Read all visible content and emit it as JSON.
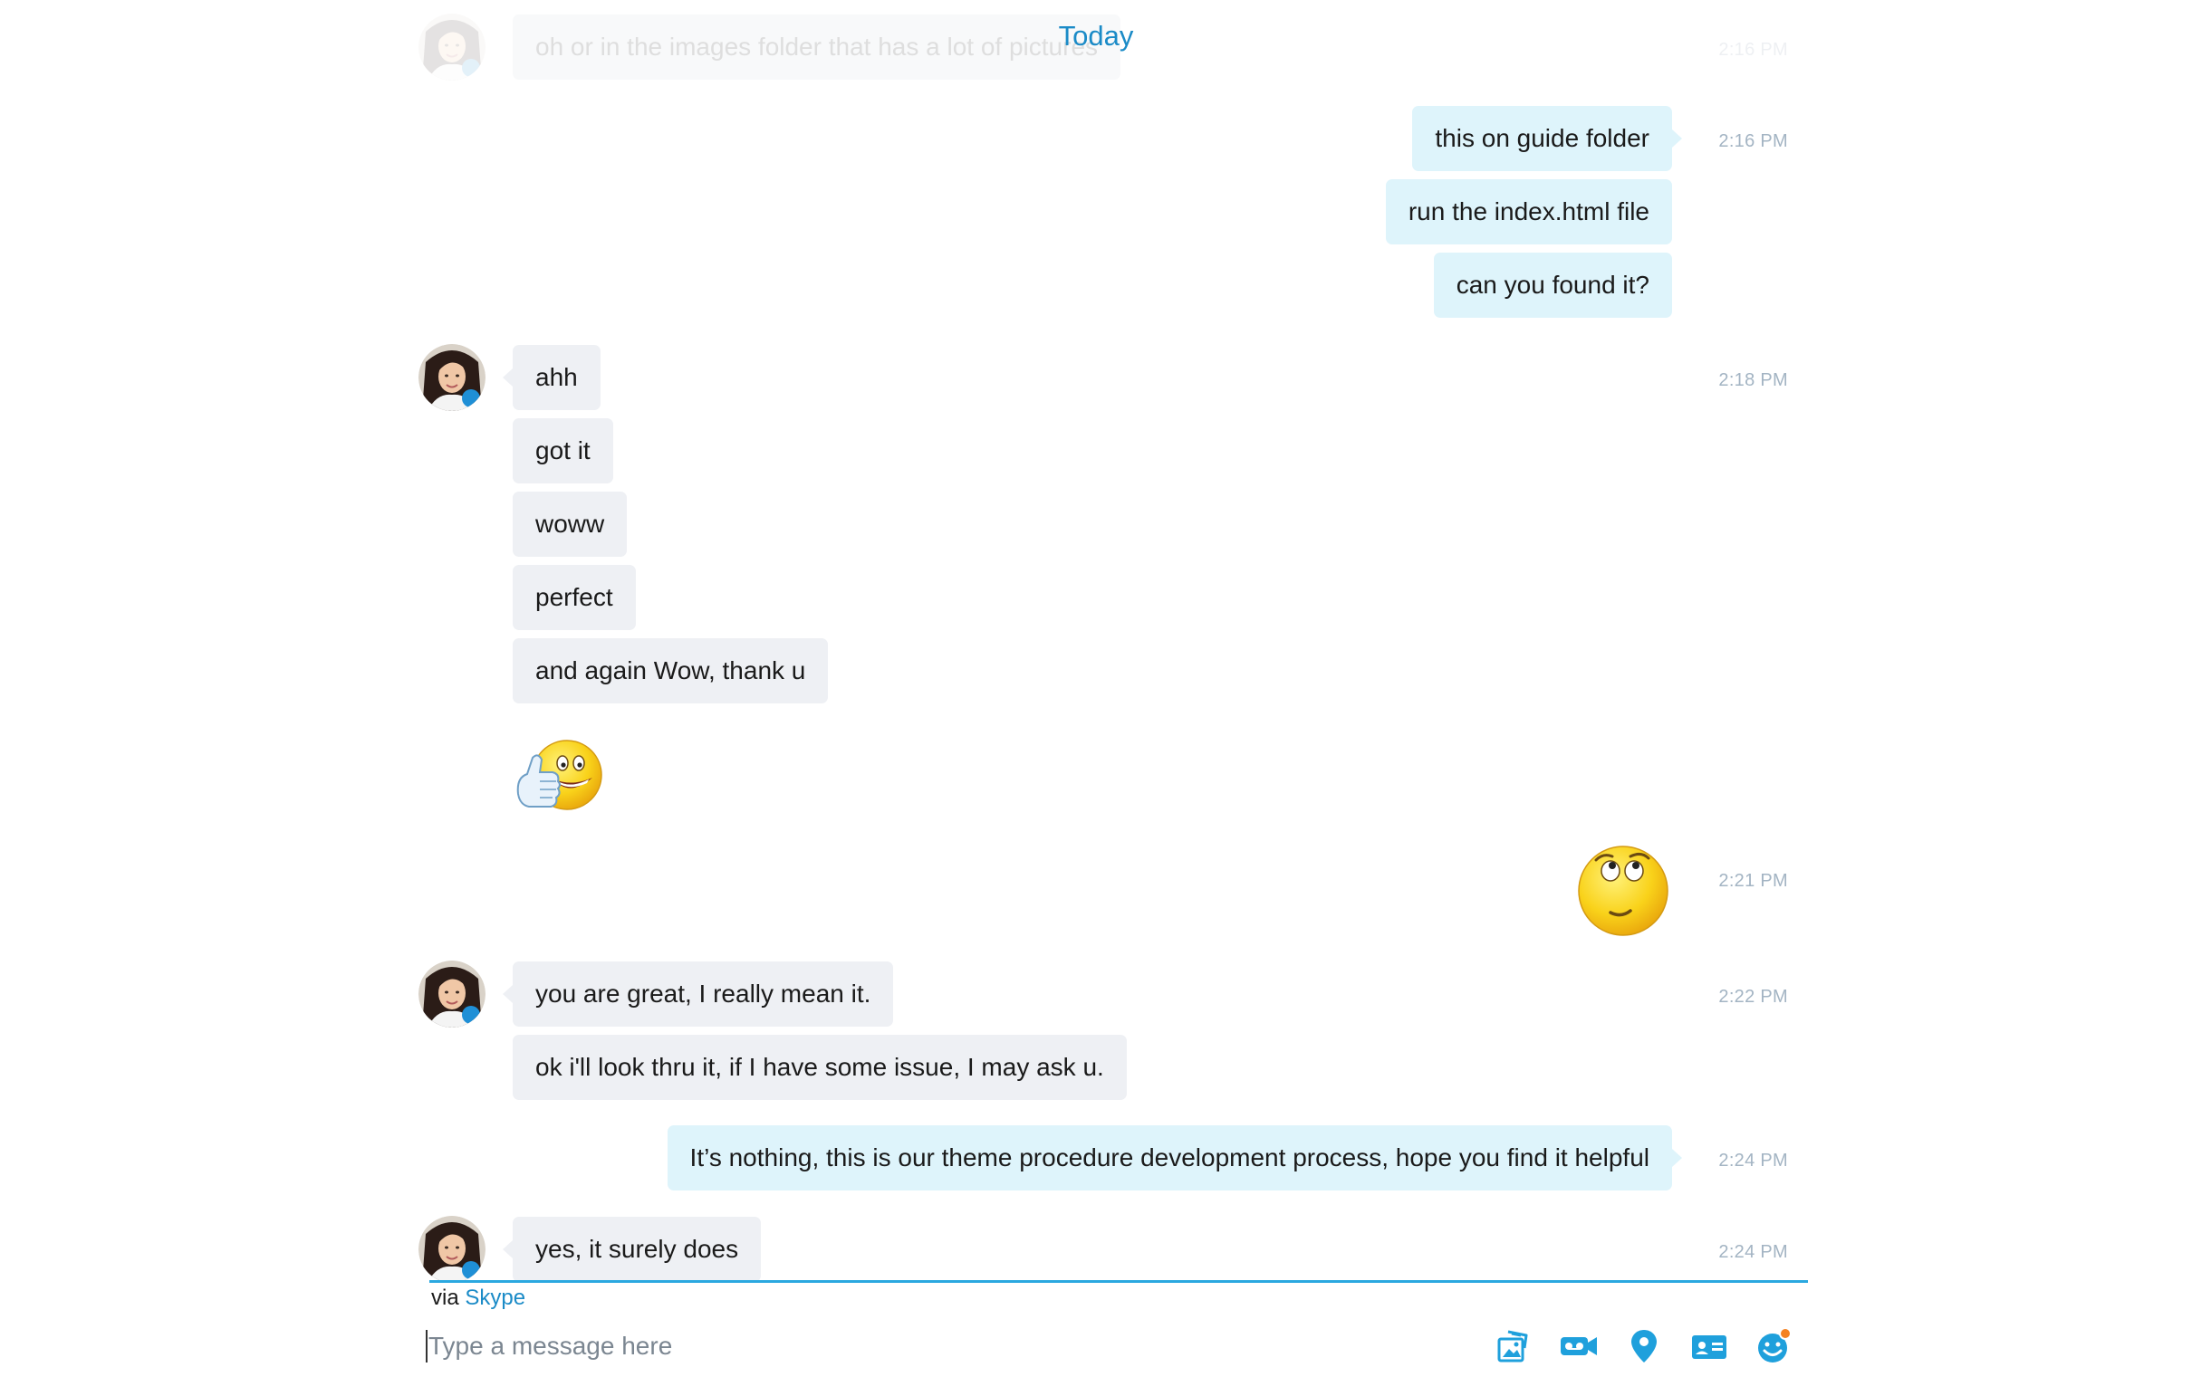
{
  "day_separator": "Today",
  "messages": [
    {
      "id": "m0",
      "direction": "in",
      "text": "oh or in the images folder that has a lot of pictures",
      "time": "2:16 PM",
      "faded": true
    },
    {
      "id": "m1",
      "direction": "out",
      "text": "this on guide folder",
      "time": "2:16 PM"
    },
    {
      "id": "m2",
      "direction": "out",
      "text": "run the index.html file"
    },
    {
      "id": "m3",
      "direction": "out",
      "text": "can you found it?"
    },
    {
      "id": "m4",
      "direction": "in",
      "text": "ahh",
      "time": "2:18 PM"
    },
    {
      "id": "m5",
      "direction": "in",
      "text": "got it"
    },
    {
      "id": "m6",
      "direction": "in",
      "text": "woww"
    },
    {
      "id": "m7",
      "direction": "in",
      "text": "perfect"
    },
    {
      "id": "m8",
      "direction": "in",
      "text": "and again Wow, thank u"
    },
    {
      "id": "m9",
      "direction": "in",
      "emoticon": "thumbs-up-smiley"
    },
    {
      "id": "m10",
      "direction": "out",
      "emoticon": "eye-roll-smiley",
      "time": "2:21 PM"
    },
    {
      "id": "m11",
      "direction": "in",
      "text": "you are great, I really mean it.",
      "time": "2:22 PM"
    },
    {
      "id": "m12",
      "direction": "in",
      "text": "ok i'll look thru it, if I have some issue, I may ask u."
    },
    {
      "id": "m13",
      "direction": "out",
      "text": "It’s nothing, this is our theme procedure development process, hope you find it helpful",
      "time": "2:24 PM"
    },
    {
      "id": "m14",
      "direction": "in",
      "text": "yes, it surely does",
      "time": "2:24 PM"
    }
  ],
  "via": {
    "prefix": "via",
    "link": "Skype"
  },
  "composer": {
    "placeholder": "Type a message here",
    "value": ""
  },
  "toolbar": {
    "icons": [
      "send-image-icon",
      "video-message-icon",
      "location-icon",
      "contact-card-icon",
      "emoticon-icon"
    ]
  },
  "colors": {
    "accent": "#1b8bc7",
    "divider": "#2aa8e0",
    "incoming_bubble": "#eef0f4",
    "outgoing_bubble": "#def4fb",
    "timestamp": "#a3b4c3",
    "notification_dot": "#f58220"
  }
}
